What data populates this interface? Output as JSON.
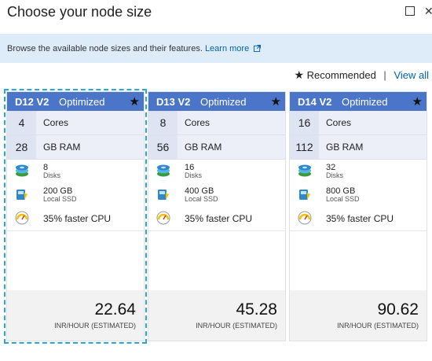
{
  "header": {
    "title": "Choose your node size"
  },
  "info_bar": {
    "text": "Browse the available node sizes and their features.",
    "link": "Learn more"
  },
  "legend": {
    "star": "★",
    "recommended": "Recommended",
    "separator": "|",
    "view_all": "View all"
  },
  "cards": [
    {
      "name": "D12 V2",
      "tier": "Optimized",
      "star": "★",
      "cores": "4",
      "cores_label": "Cores",
      "ram": "28",
      "ram_label": "GB RAM",
      "disks": "8",
      "disks_label": "Disks",
      "ssd": "200 GB",
      "ssd_label": "Local SSD",
      "cpu": "35% faster CPU",
      "price": "22.64",
      "price_unit": "INR/HOUR (ESTIMATED)",
      "selected": true
    },
    {
      "name": "D13 V2",
      "tier": "Optimized",
      "star": "★",
      "cores": "8",
      "cores_label": "Cores",
      "ram": "56",
      "ram_label": "GB RAM",
      "disks": "16",
      "disks_label": "Disks",
      "ssd": "400 GB",
      "ssd_label": "Local SSD",
      "cpu": "35% faster CPU",
      "price": "45.28",
      "price_unit": "INR/HOUR (ESTIMATED)",
      "selected": false
    },
    {
      "name": "D14 V2",
      "tier": "Optimized",
      "star": "★",
      "cores": "16",
      "cores_label": "Cores",
      "ram": "112",
      "ram_label": "GB RAM",
      "disks": "32",
      "disks_label": "Disks",
      "ssd": "800 GB",
      "ssd_label": "Local SSD",
      "cpu": "35% faster CPU",
      "price": "90.62",
      "price_unit": "INR/HOUR (ESTIMATED)",
      "selected": false
    }
  ],
  "icons": {
    "disks": "disk-stack-icon",
    "ssd": "ssd-icon",
    "cpu": "gauge-icon",
    "maximize": "maximize-icon",
    "close": "close-icon",
    "external": "external-link-icon"
  },
  "colors": {
    "card_header": "#4a75c8",
    "selection": "#2aa7d5",
    "info_bar": "#deecf9",
    "link": "#0063b1"
  }
}
